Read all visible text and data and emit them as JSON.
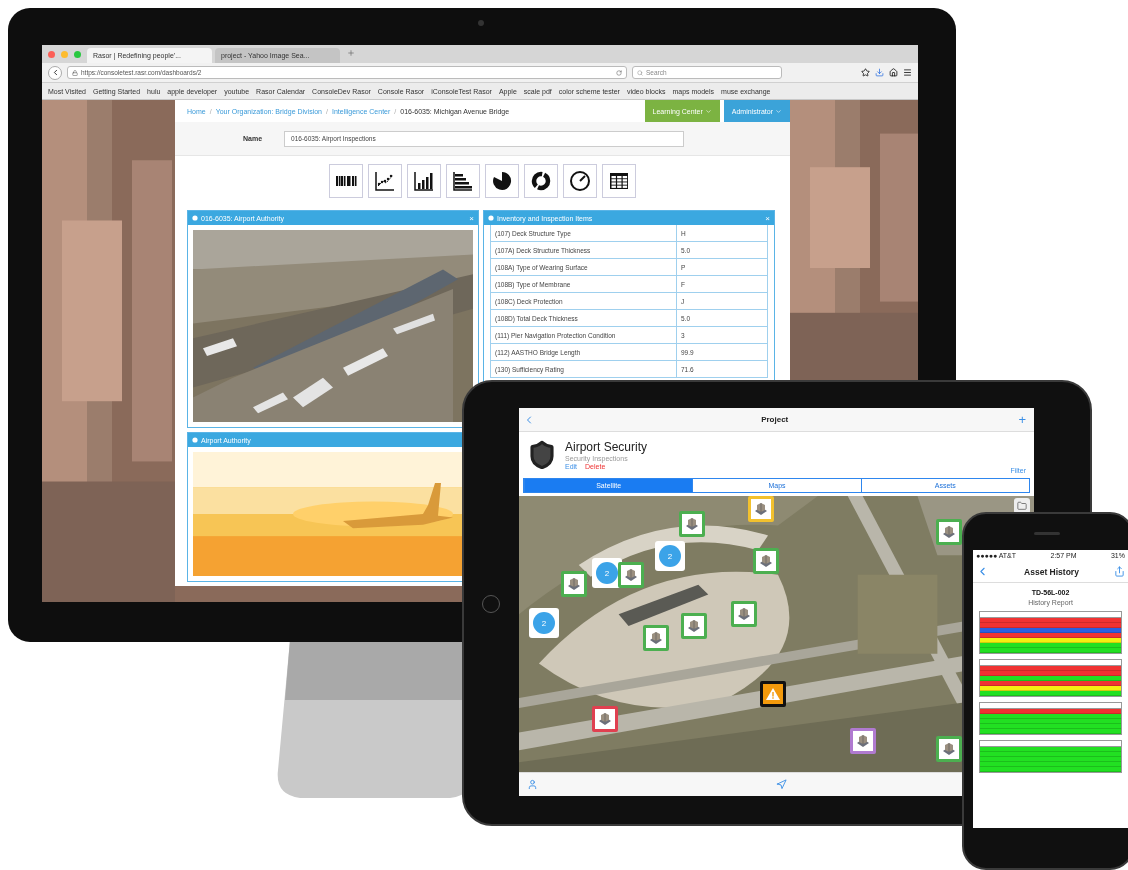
{
  "browser": {
    "tabs": [
      {
        "title": "Rasor | Redefining people'...",
        "selected": true
      },
      {
        "title": "project - Yahoo Image Sea...",
        "selected": false
      }
    ],
    "url": "https://consoletest.rasr.com/dashboards/2",
    "search": {
      "placeholder": "Search"
    },
    "bookmarks": [
      "Most Visited",
      "Getting Started",
      "hulu",
      "apple developer",
      "youtube",
      "Rasor Calendar",
      "ConsoleDev Rasor",
      "Console Rasor",
      "iConsoleTest Rasor",
      "Apple",
      "scale pdf",
      "color scheme tester",
      "video blocks",
      "maps models",
      "muse exchange"
    ]
  },
  "page": {
    "separator": "/",
    "breadcrumbs": [
      "Home",
      "Your Organization: Bridge Division",
      "Intelligence Center",
      "016-6035: Michigan Avenue Bridge"
    ],
    "menus": [
      {
        "label": "Learning Center",
        "color": "#7cb342"
      },
      {
        "label": "Administrator",
        "color": "#3ba3d9"
      }
    ],
    "name_field": {
      "label": "Name",
      "value": "016-6035: Airport Inspections"
    },
    "chart_types": [
      {
        "kind": "stripes"
      },
      {
        "kind": "scatter"
      },
      {
        "kind": "bar"
      },
      {
        "kind": "hbar"
      },
      {
        "kind": "pie"
      },
      {
        "kind": "donut"
      },
      {
        "kind": "gauge"
      },
      {
        "kind": "table"
      }
    ],
    "panels": [
      {
        "title": "016-6035: Airport Authority",
        "close": "×"
      },
      {
        "kind": "table",
        "title": "Inventory and Inspection Items",
        "close": "×",
        "rows": [
          {
            "item": "(107) Deck Structure Type",
            "value": "H"
          },
          {
            "item": "(107A) Deck Structure Thickness",
            "value": "5.0"
          },
          {
            "item": "(108A) Type of Wearing Surface",
            "value": "P"
          },
          {
            "item": "(108B) Type of Membrane",
            "value": "F"
          },
          {
            "item": "(108C) Deck Protection",
            "value": "J"
          },
          {
            "item": "(108D) Total Deck Thickness",
            "value": "5.0"
          },
          {
            "item": "(111) Pier Navigation Protection Condition",
            "value": "3"
          },
          {
            "item": "(112) AASTHO Bridge Length",
            "value": "99.9"
          },
          {
            "item": "(130) Sufficiency Rating",
            "value": "71.6"
          }
        ]
      },
      {
        "title": "Airport Authority"
      }
    ]
  },
  "tablet": {
    "title": "Project",
    "add": "+",
    "project": {
      "name": "Airport Security",
      "subtitle": "Security Inspections",
      "edit": "Edit",
      "delete": "Delete",
      "filter": "Filter"
    },
    "segments": [
      {
        "label": "Satellite",
        "selected": true
      },
      {
        "label": "Maps",
        "selected": false
      },
      {
        "label": "Assets",
        "selected": false
      }
    ],
    "markers": [
      {
        "kind": "cluster",
        "count": "2"
      },
      {
        "kind": "cluster",
        "count": "2"
      },
      {
        "kind": "cluster",
        "count": "2"
      },
      {
        "kind": "asset",
        "color": "#4caf50"
      },
      {
        "kind": "asset",
        "color": "#4caf50"
      },
      {
        "kind": "asset",
        "color": "#4caf50"
      },
      {
        "kind": "asset",
        "color": "#4caf50"
      },
      {
        "kind": "asset",
        "color": "#4caf50"
      },
      {
        "kind": "asset",
        "color": "#4caf50"
      },
      {
        "kind": "asset",
        "color": "#4caf50"
      },
      {
        "kind": "asset",
        "color": "#4caf50"
      },
      {
        "kind": "asset",
        "color": "#4caf50"
      },
      {
        "kind": "asset",
        "color": "#f2c12e"
      },
      {
        "kind": "asset",
        "color": "#e04050"
      },
      {
        "kind": "asset",
        "color": "#b07ad0"
      },
      {
        "kind": "alert",
        "color": "#111111"
      }
    ]
  },
  "phone": {
    "carrier": "●●●●● AT&T",
    "time": "2:57 PM",
    "battery": "31%",
    "title": "Asset History",
    "report": {
      "title": "TD-56L-002",
      "subtitle": "History Report",
      "sections": [
        {
          "rows": [
            {
              "color": "#f03232"
            },
            {
              "color": "#f03232"
            },
            {
              "color": "#2a5fe0"
            },
            {
              "color": "#f03232"
            },
            {
              "color": "#f5ee10"
            },
            {
              "color": "#22e022"
            },
            {
              "color": "#22e022"
            }
          ]
        },
        {
          "rows": [
            {
              "color": "#f03232"
            },
            {
              "color": "#f03232"
            },
            {
              "color": "#22e022"
            },
            {
              "color": "#f03232"
            },
            {
              "color": "#f5ee10"
            },
            {
              "color": "#22e022"
            }
          ]
        },
        {
          "rows": [
            {
              "color": "#f03232"
            },
            {
              "color": "#22e022"
            },
            {
              "color": "#22e022"
            },
            {
              "color": "#22e022"
            },
            {
              "color": "#22e022"
            }
          ]
        },
        {
          "rows": [
            {
              "color": "#22e022"
            },
            {
              "color": "#22e022"
            },
            {
              "color": "#22e022"
            },
            {
              "color": "#22e022"
            },
            {
              "color": "#22e022"
            }
          ]
        }
      ]
    }
  }
}
